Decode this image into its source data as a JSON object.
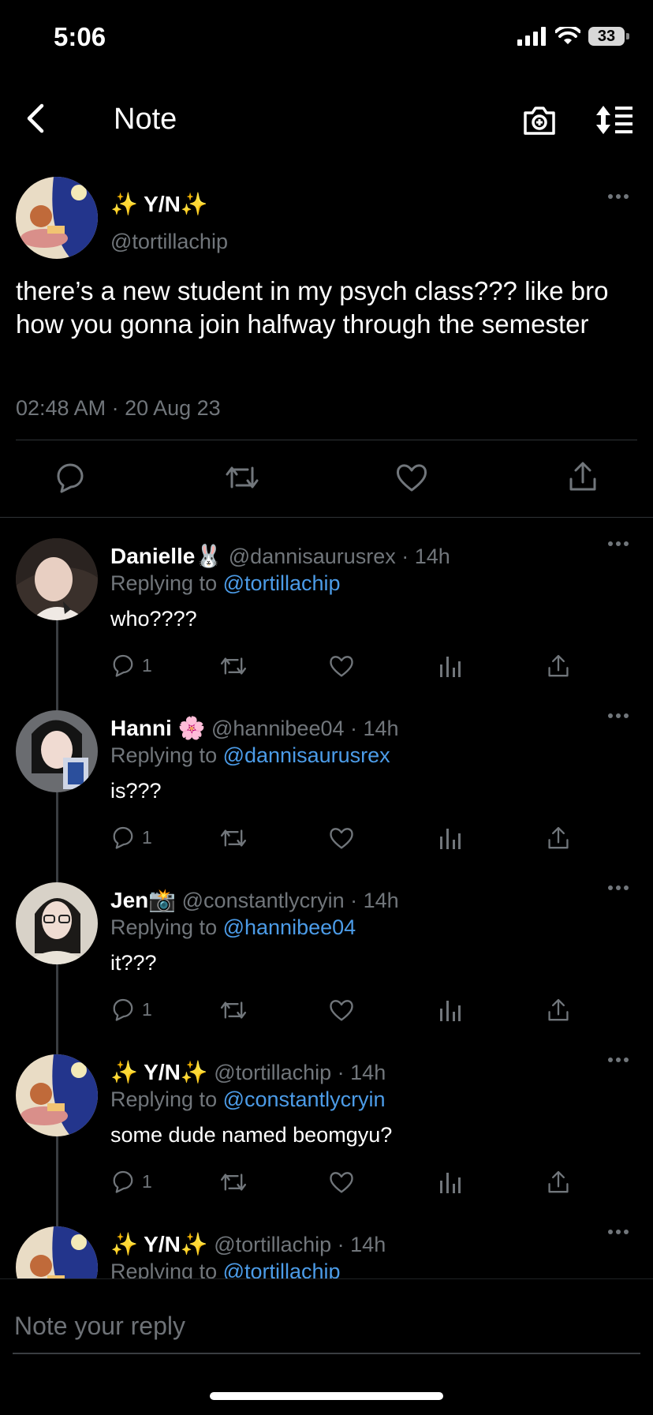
{
  "status_bar": {
    "time": "5:06",
    "battery": "33"
  },
  "header": {
    "title": "Note"
  },
  "main_tweet": {
    "name": "✨ Y/N✨",
    "handle": "@tortillachip",
    "text": "there’s a new student in my psych class??? like bro how you gonna join halfway through the semester",
    "timestamp": "02:48 AM · 20 Aug 23"
  },
  "replies": [
    {
      "name": "Danielle🐰",
      "handle": "@dannisaurusrex · 14h",
      "replying_prefix": "Replying to ",
      "replying_to": "@tortillachip",
      "text": "who????",
      "reply_count": "1"
    },
    {
      "name": "Hanni 🌸",
      "handle": "@hannibee04 · 14h",
      "replying_prefix": "Replying to ",
      "replying_to": "@dannisaurusrex",
      "text": "is???",
      "reply_count": "1"
    },
    {
      "name": "Jen📸",
      "handle": "@constantlycryin · 14h",
      "replying_prefix": "Replying to ",
      "replying_to": "@hannibee04",
      "text": "it???",
      "reply_count": "1"
    },
    {
      "name": "✨ Y/N✨",
      "handle": "@tortillachip · 14h",
      "replying_prefix": "Replying to ",
      "replying_to": "@constantlycryin",
      "text": "some dude named beomgyu?",
      "reply_count": "1"
    },
    {
      "name": "✨ Y/N✨",
      "handle": "@tortillachip · 14h",
      "replying_prefix": "Replying to ",
      "replying_to": "@tortillachip",
      "text": "",
      "reply_count": ""
    }
  ],
  "compose": {
    "placeholder": "Note your reply"
  },
  "colors": {
    "background": "#000000",
    "accent": "#4c9ce8",
    "muted": "#71767b"
  },
  "icons": [
    "back-icon",
    "camera-icon",
    "sort-icon",
    "more-icon",
    "reply-icon",
    "retweet-icon",
    "like-icon",
    "share-icon",
    "analytics-icon"
  ]
}
